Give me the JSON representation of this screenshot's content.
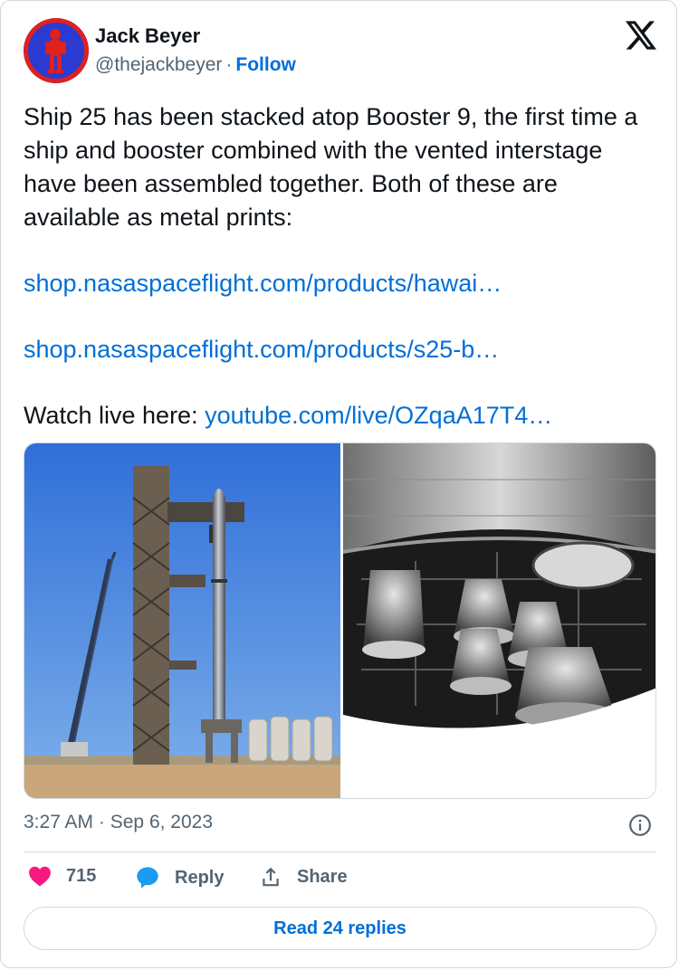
{
  "author": {
    "name": "Jack Beyer",
    "handle": "@thejackbeyer",
    "separator": "·",
    "follow_label": "Follow",
    "avatar_icon": "astronaut-avatar",
    "brand_icon": "x-logo-icon"
  },
  "tweet": {
    "text": "Ship 25 has been stacked atop Booster 9, the first time a ship and booster combined with the vented interstage have been assembled together. Both of these are available as metal prints:",
    "link1": "shop.nasaspaceflight.com/products/hawai…",
    "link2": "shop.nasaspaceflight.com/products/s25-b…",
    "watch_prefix": "Watch live here: ",
    "watch_link": "youtube.com/live/OZqaA17T4…"
  },
  "meta": {
    "time": "3:27 AM",
    "separator": "·",
    "date": "Sep 6, 2023"
  },
  "actions": {
    "like_count": "715",
    "reply_label": "Reply",
    "share_label": "Share"
  },
  "read_replies_label": "Read 24 replies",
  "colors": {
    "link": "#006fd6",
    "like": "#f91880",
    "reply": "#1d9bf0",
    "muted": "#536471",
    "border": "#cfd9de"
  }
}
